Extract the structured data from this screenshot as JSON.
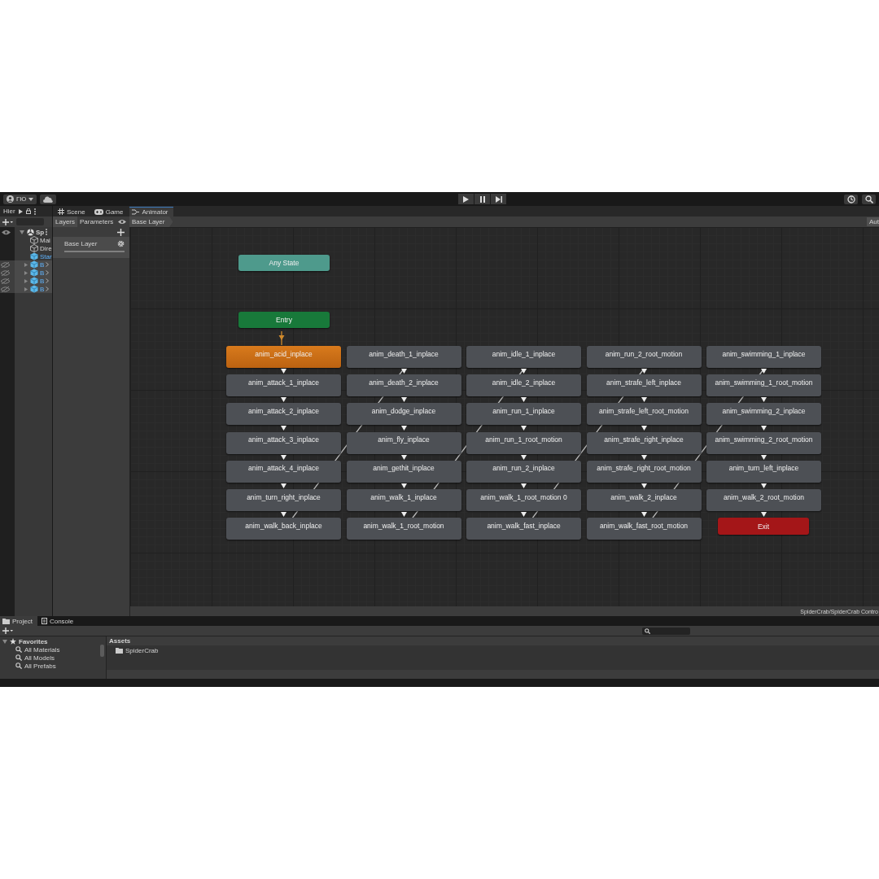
{
  "toolbar": {
    "account": "ГЮ"
  },
  "hierarchy": {
    "tab": "Hier",
    "items": [
      {
        "name": "Sp",
        "expanded": true,
        "children": [
          {
            "name": "Mai",
            "kind": "object",
            "hidden": false
          },
          {
            "name": "Dire",
            "kind": "object",
            "hidden": false
          },
          {
            "name": "Star",
            "kind": "prefab-text",
            "hidden": false
          },
          {
            "name": "B",
            "kind": "prefab",
            "hidden": true
          },
          {
            "name": "B",
            "kind": "prefab",
            "hidden": true
          },
          {
            "name": "B",
            "kind": "prefab",
            "hidden": true
          },
          {
            "name": "B",
            "kind": "prefab",
            "hidden": true
          }
        ]
      }
    ]
  },
  "view_tabs": [
    {
      "label": "Scene",
      "kind": "scene",
      "selected": false
    },
    {
      "label": "Game",
      "kind": "game",
      "selected": false
    },
    {
      "label": "Animator",
      "kind": "animator",
      "selected": true
    }
  ],
  "animator": {
    "panel_tabs": [
      {
        "label": "Layers",
        "selected": true
      },
      {
        "label": "Parameters",
        "selected": false
      }
    ],
    "breadcrumb": "Base Layer",
    "auto_button": "Aut",
    "layers": [
      {
        "name": "Base Layer"
      }
    ],
    "any_state": "Any State",
    "entry": "Entry",
    "exit": "Exit",
    "columns": [
      [
        {
          "name": "anim_acid_inplace",
          "default": true
        },
        {
          "name": "anim_attack_1_inplace",
          "default": false
        },
        {
          "name": "anim_attack_2_inplace",
          "default": false
        },
        {
          "name": "anim_attack_3_inplace",
          "default": false
        },
        {
          "name": "anim_attack_4_inplace",
          "default": false
        },
        {
          "name": "anim_turn_right_inplace",
          "default": false
        },
        {
          "name": "anim_walk_back_inplace",
          "default": false
        }
      ],
      [
        {
          "name": "anim_death_1_inplace",
          "default": false
        },
        {
          "name": "anim_death_2_inplace",
          "default": false
        },
        {
          "name": "anim_dodge_inplace",
          "default": false
        },
        {
          "name": "anim_fly_inplace",
          "default": false
        },
        {
          "name": "anim_gethit_inplace",
          "default": false
        },
        {
          "name": "anim_walk_1_inplace",
          "default": false
        },
        {
          "name": "anim_walk_1_root_motion",
          "default": false
        }
      ],
      [
        {
          "name": "anim_idle_1_inplace",
          "default": false
        },
        {
          "name": "anim_idle_2_inplace",
          "default": false
        },
        {
          "name": "anim_run_1_inplace",
          "default": false
        },
        {
          "name": "anim_run_1_root_motion",
          "default": false
        },
        {
          "name": "anim_run_2_inplace",
          "default": false
        },
        {
          "name": "anim_walk_1_root_motion 0",
          "default": false
        },
        {
          "name": "anim_walk_fast_inplace",
          "default": false
        }
      ],
      [
        {
          "name": "anim_run_2_root_motion",
          "default": false
        },
        {
          "name": "anim_strafe_left_inplace",
          "default": false
        },
        {
          "name": "anim_strafe_left_root_motion",
          "default": false
        },
        {
          "name": "anim_strafe_right_inplace",
          "default": false
        },
        {
          "name": "anim_strafe_right_root_motion",
          "default": false
        },
        {
          "name": "anim_walk_2_inplace",
          "default": false
        },
        {
          "name": "anim_walk_fast_root_motion",
          "default": false
        }
      ],
      [
        {
          "name": "anim_swimming_1_inplace",
          "default": false
        },
        {
          "name": "anim_swimming_1_root_motion",
          "default": false
        },
        {
          "name": "anim_swimming_2_inplace",
          "default": false
        },
        {
          "name": "anim_swimming_2_root_motion",
          "default": false
        },
        {
          "name": "anim_turn_left_inplace",
          "default": false
        },
        {
          "name": "anim_walk_2_root_motion",
          "default": false
        }
      ]
    ],
    "path": "SpiderCrab/SpiderCrab Contro"
  },
  "project": {
    "tabs": [
      {
        "label": "Project",
        "kind": "project",
        "selected": true
      },
      {
        "label": "Console",
        "kind": "console",
        "selected": false
      }
    ],
    "favorites": {
      "label": "Favorites",
      "expanded": true,
      "children": [
        "All Materials",
        "All Models",
        "All Prefabs"
      ]
    },
    "assets_header": "Assets",
    "folders": [
      "SpiderCrab"
    ]
  }
}
